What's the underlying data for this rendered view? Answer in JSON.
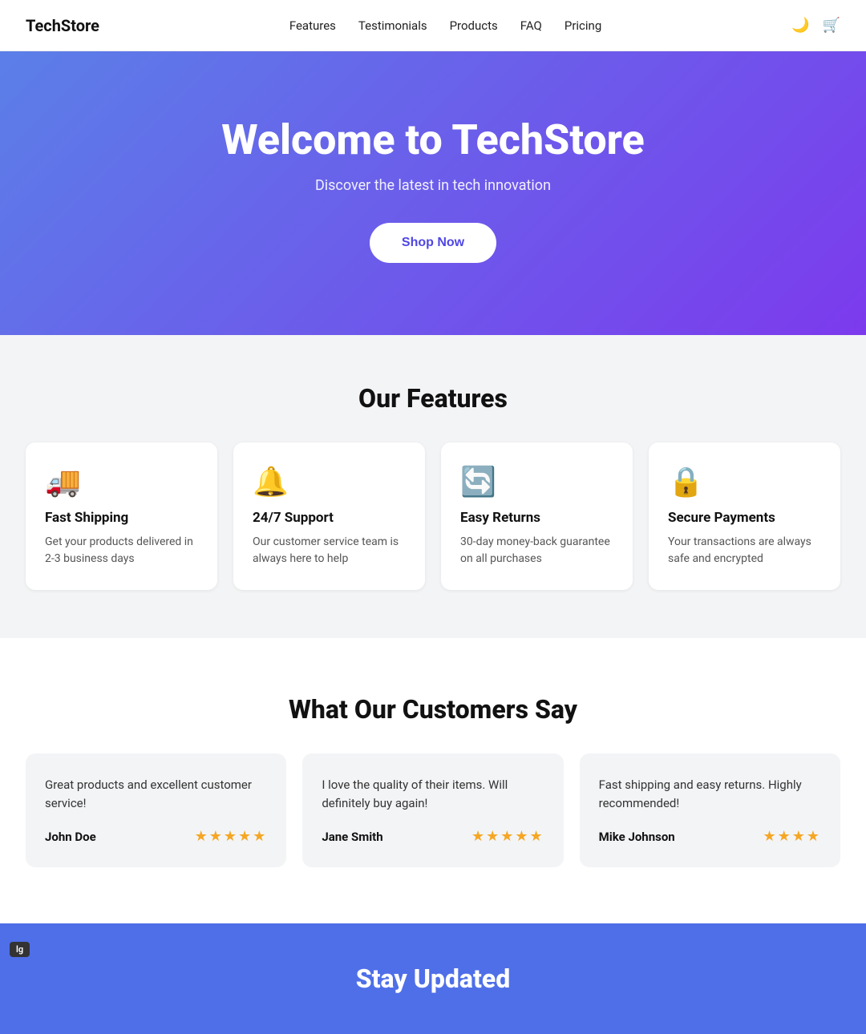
{
  "nav": {
    "logo": "TechStore",
    "links": [
      {
        "label": "Features",
        "href": "#features"
      },
      {
        "label": "Testimonials",
        "href": "#testimonials"
      },
      {
        "label": "Products",
        "href": "#products"
      },
      {
        "label": "FAQ",
        "href": "#faq"
      },
      {
        "label": "Pricing",
        "href": "#pricing"
      }
    ],
    "dark_mode_icon": "🌙",
    "cart_icon": "🛒"
  },
  "hero": {
    "title": "Welcome to TechStore",
    "subtitle": "Discover the latest in tech innovation",
    "cta_label": "Shop Now"
  },
  "features": {
    "section_title": "Our Features",
    "items": [
      {
        "icon": "🚚",
        "title": "Fast Shipping",
        "description": "Get your products delivered in 2-3 business days"
      },
      {
        "icon": "🔔",
        "title": "24/7 Support",
        "description": "Our customer service team is always here to help"
      },
      {
        "icon": "🔄",
        "title": "Easy Returns",
        "description": "30-day money-back guarantee on all purchases"
      },
      {
        "icon": "🔒",
        "title": "Secure Payments",
        "description": "Your transactions are always safe and encrypted"
      }
    ]
  },
  "testimonials": {
    "section_title": "What Our Customers Say",
    "items": [
      {
        "text": "Great products and excellent customer service!",
        "author": "John Doe",
        "stars": "★★★★★"
      },
      {
        "text": "I love the quality of their items. Will definitely buy again!",
        "author": "Jane Smith",
        "stars": "★★★★★"
      },
      {
        "text": "Fast shipping and easy returns. Highly recommended!",
        "author": "Mike Johnson",
        "stars": "★★★★"
      }
    ]
  },
  "footer_banner": {
    "title": "Stay Updated"
  },
  "bp_badge": "lg"
}
